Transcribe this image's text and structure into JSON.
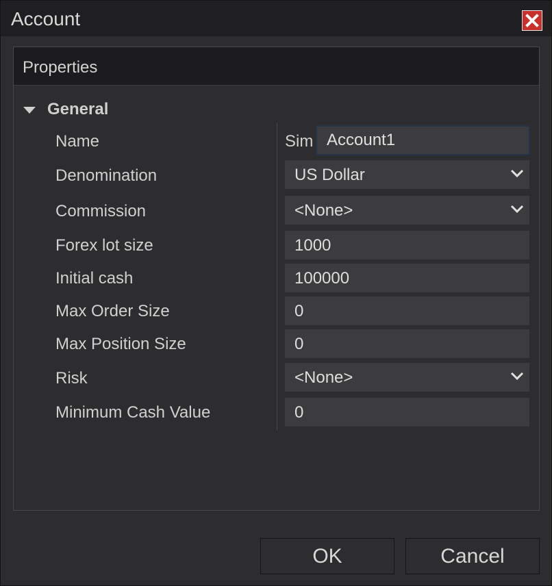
{
  "window": {
    "title": "Account",
    "close_icon": "close-icon"
  },
  "panel": {
    "header": "Properties",
    "group": {
      "label": "General",
      "expanded": true,
      "icon": "caret-down-icon"
    }
  },
  "properties": {
    "name": {
      "label": "Name",
      "prefix": "Sim",
      "value": "Account1"
    },
    "denomination": {
      "label": "Denomination",
      "value": "US Dollar",
      "type": "dropdown"
    },
    "commission": {
      "label": "Commission",
      "value": "<None>",
      "type": "dropdown"
    },
    "forex_lot_size": {
      "label": "Forex lot size",
      "value": "1000"
    },
    "initial_cash": {
      "label": "Initial cash",
      "value": "100000"
    },
    "max_order_size": {
      "label": "Max Order Size",
      "value": "0"
    },
    "max_position_size": {
      "label": "Max Position Size",
      "value": "0"
    },
    "risk": {
      "label": "Risk",
      "value": "<None>",
      "type": "dropdown"
    },
    "minimum_cash_value": {
      "label": "Minimum Cash Value",
      "value": "0"
    }
  },
  "buttons": {
    "ok": "OK",
    "cancel": "Cancel"
  },
  "colors": {
    "background": "#2d2d2f",
    "titlebar": "#1f1f21",
    "field": "#3c3c3e",
    "close_button": "#c9302c",
    "focus_border": "#253349"
  }
}
